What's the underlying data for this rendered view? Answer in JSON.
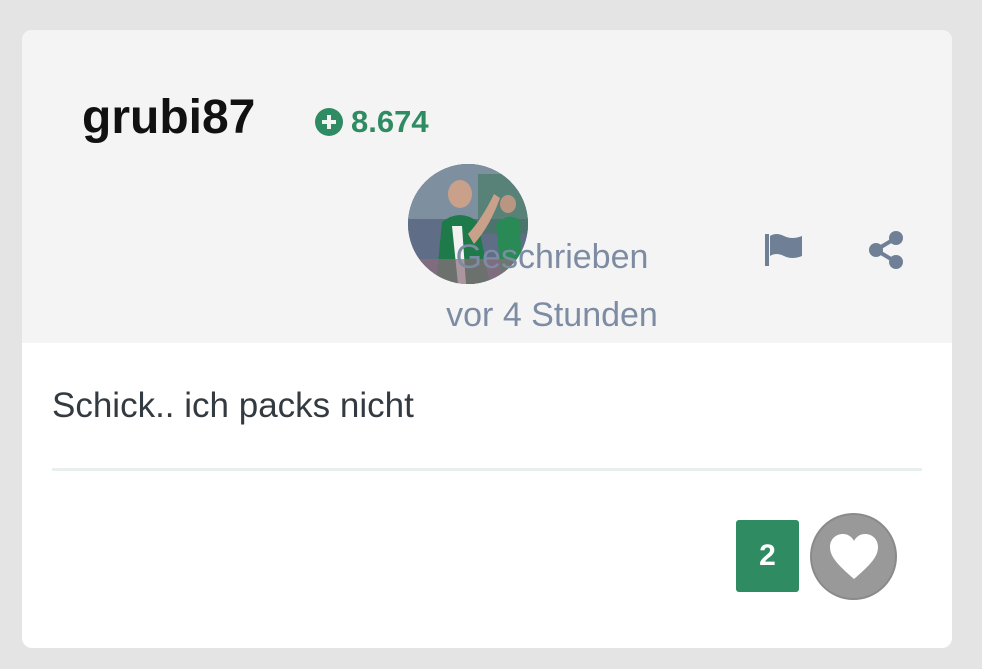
{
  "post": {
    "username": "grubi87",
    "score": "8.674",
    "meta_line1": "Geschrieben",
    "meta_line2": "vor 4 Stunden",
    "body": "Schick.. ich packs nicht",
    "like_count": "2"
  },
  "icons": {
    "score": "plus-circle-icon",
    "report": "flag-icon",
    "share": "share-icon",
    "like": "heart-icon"
  },
  "colors": {
    "accent": "#2e8b62",
    "meta_text": "#7d8ca3",
    "like_button": "#999999",
    "header_bg": "#f4f4f4"
  }
}
